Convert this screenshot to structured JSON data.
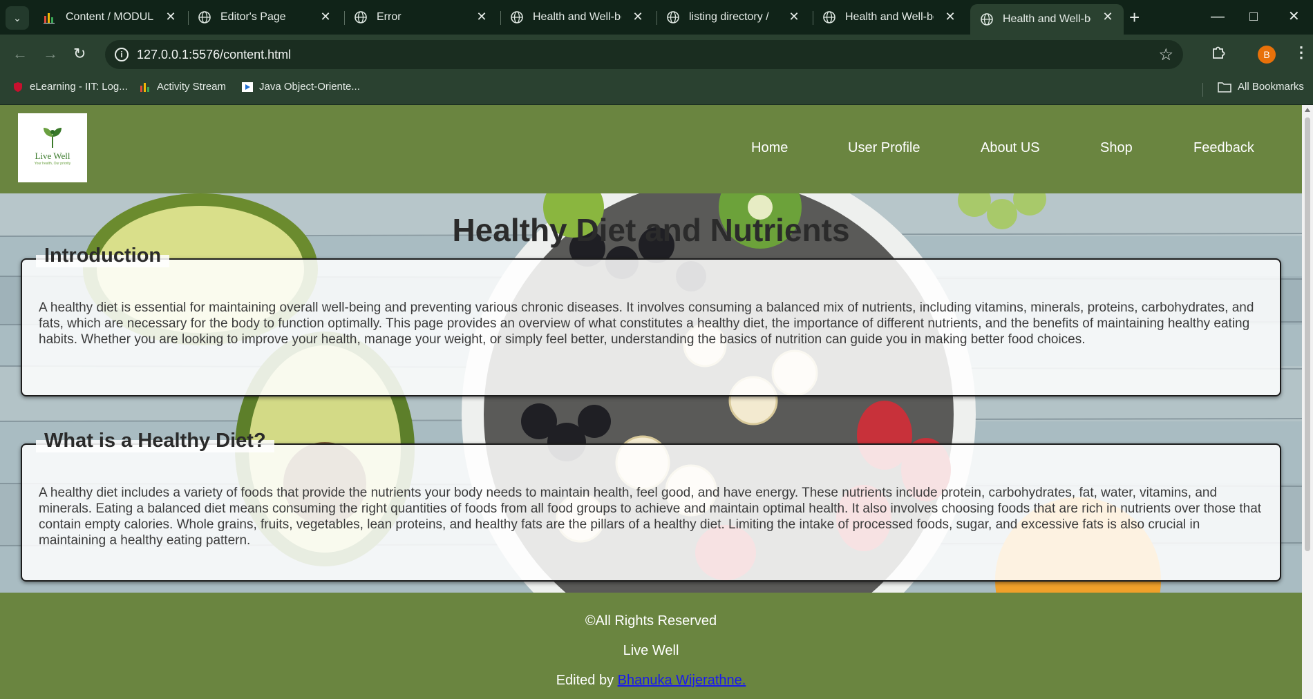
{
  "browser": {
    "tabs": [
      {
        "title": "Content / MODULE: (",
        "icon": "chart-favicon-icon"
      },
      {
        "title": "Editor's Page",
        "icon": "globe-icon"
      },
      {
        "title": "Error",
        "icon": "globe-icon"
      },
      {
        "title": "Health and Well-bein",
        "icon": "globe-icon"
      },
      {
        "title": "listing directory /",
        "icon": "globe-icon"
      },
      {
        "title": "Health and Well-bein",
        "icon": "globe-icon"
      },
      {
        "title": "Health and Well-bein",
        "icon": "globe-icon",
        "active": true
      }
    ],
    "url": "127.0.0.1:5576/content.html",
    "profile_initial": "B",
    "bookmarks": [
      {
        "label": "eLearning - IIT: Log...",
        "icon": "shield-icon"
      },
      {
        "label": "Activity Stream",
        "icon": "chart-favicon-icon"
      },
      {
        "label": "Java Object-Oriente...",
        "icon": "video-icon"
      }
    ],
    "all_bookmarks": "All Bookmarks"
  },
  "site": {
    "logo": {
      "brand": "Live Well",
      "tagline": "Your health, Our priority"
    },
    "nav": [
      "Home",
      "User Profile",
      "About US",
      "Shop",
      "Feedback"
    ],
    "page_title": "Healthy Diet and Nutrients",
    "sections": [
      {
        "heading": "Introduction",
        "body": "A healthy diet is essential for maintaining overall well-being and preventing various chronic diseases. It involves consuming a balanced mix of nutrients, including vitamins, minerals, proteins, carbohydrates, and fats, which are necessary for the body to function optimally. This page provides an overview of what constitutes a healthy diet, the importance of different nutrients, and the benefits of maintaining healthy eating habits. Whether you are looking to improve your health, manage your weight, or simply feel better, understanding the basics of nutrition can guide you in making better food choices."
      },
      {
        "heading": "What is a Healthy Diet?",
        "body": "A healthy diet includes a variety of foods that provide the nutrients your body needs to maintain health, feel good, and have energy. These nutrients include protein, carbohydrates, fat, water, vitamins, and minerals. Eating a balanced diet means consuming the right quantities of foods from all food groups to achieve and maintain optimal health. It also involves choosing foods that are rich in nutrients over those that contain empty calories. Whole grains, fruits, vegetables, lean proteins, and healthy fats are the pillars of a healthy diet. Limiting the intake of processed foods, sugar, and excessive fats is also crucial in maintaining a healthy eating pattern."
      }
    ],
    "footer": {
      "rights": "©All Rights Reserved",
      "name": "Live Well",
      "edited_prefix": "Edited by ",
      "author": "Bhanuka Wijerathne."
    }
  },
  "colors": {
    "header_green": "#6a8540",
    "profile_orange": "#e8710a",
    "link_blue": "#1a1aee"
  }
}
